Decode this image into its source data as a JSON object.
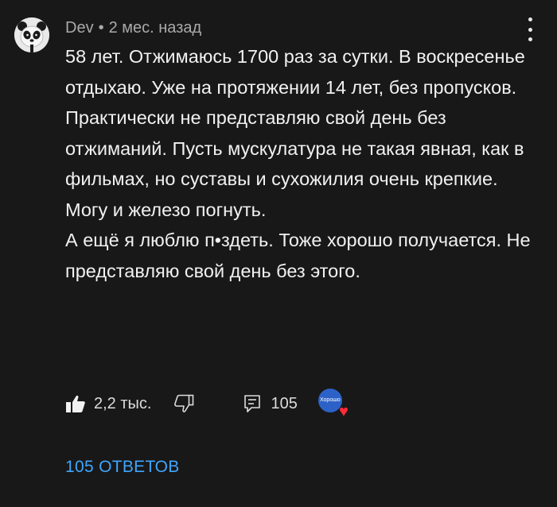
{
  "comment": {
    "author": "Dev",
    "separator": "•",
    "time": "2 мес. назад",
    "paragraphs": [
      "58 лет. Отжимаюсь 1700 раз за сутки. В воскресенье отдыхаю. Уже на протяжении 14 лет, без пропусков. Практически не представляю свой день без отжиманий. Пусть мускулатура не такая явная, как в фильмах, но суставы и сухожилия очень крепкие. Могу и железо погнуть.",
      "А ещё я люблю п•здеть. Тоже хорошо получается. Не представляю свой день без этого."
    ],
    "likes": "2,2 тыс.",
    "replies_count": "105",
    "creator_avatar_text": "Хорошо Сделано",
    "creator_heart": "♥",
    "view_replies": "105 ОТВЕТОВ"
  },
  "colors": {
    "background": "#181818",
    "text": "#f1f1f1",
    "meta": "#aaaaaa",
    "link": "#3ea6ff",
    "heart": "#ff2b3b"
  },
  "icons": [
    "panda-avatar",
    "kebab-menu-icon",
    "thumbs-up-icon",
    "thumbs-down-icon",
    "reply-comment-icon",
    "creator-heart-icon"
  ]
}
